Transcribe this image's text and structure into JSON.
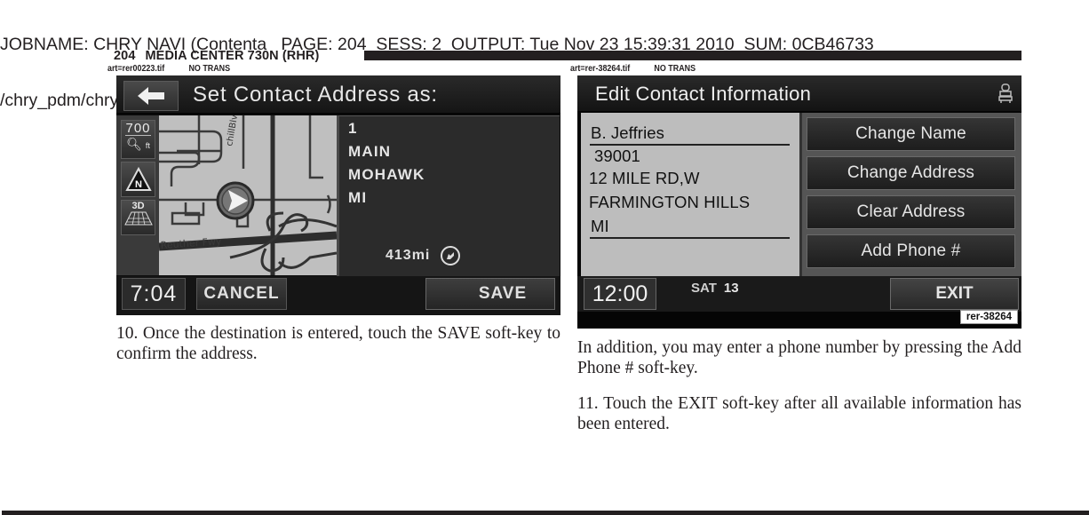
{
  "job_header": {
    "line1": "JOBNAME: CHRY NAVI (Contenta   PAGE: 204  SESS: 2  OUTPUT: Tue Nov 23 15:39:31 2010  SUM: 0CB46733",
    "line2": "/chry_pdm/chrysler/navi/rhr/navi"
  },
  "running_head": {
    "page_number": "204",
    "section_title": "MEDIA CENTER 730N (RHR)"
  },
  "figures": [
    {
      "art_file": "art=rer00223.tif",
      "trans_note": "NO TRANS",
      "screen": {
        "back_icon": "left-arrow-icon",
        "title": "Set Contact Address as:",
        "map": {
          "scale_value": "700",
          "scale_unit": "ft",
          "north_label": "N",
          "view_3d_label": "3D",
          "road_labels": [
            "Blvd",
            "Reuther Fwy"
          ]
        },
        "address_lines": [
          "1",
          "MAIN",
          "MOHAWK",
          "MI"
        ],
        "distance": "413mi",
        "distance_icon": "direction-arrow-icon",
        "clock": "7:04",
        "cancel_label": "CANCEL",
        "save_label": "SAVE"
      }
    },
    {
      "art_file": "art=rer-38264.tif",
      "trans_note": "NO TRANS",
      "screen": {
        "title": "Edit Contact Information",
        "status_icon": "seat-icon",
        "contact": {
          "name": "B. Jeffries",
          "street_number": "39001",
          "street": "12 MILE RD,W",
          "city": "FARMINGTON HILLS",
          "state": "MI"
        },
        "buttons": [
          "Change Name",
          "Change Address",
          "Clear Address",
          "Add Phone #"
        ],
        "clock": "12:00",
        "day": "SAT",
        "date": "13",
        "exit_label": "EXIT",
        "figure_tag": "rer-38264"
      }
    }
  ],
  "body": {
    "step10": "10. Once the destination is entered, touch the SAVE soft-key to confirm the address.",
    "phone_note": "In addition, you may enter a phone number by pressing the Add Phone # soft-key.",
    "step11": "11. Touch the EXIT soft-key after all available information has been entered."
  }
}
